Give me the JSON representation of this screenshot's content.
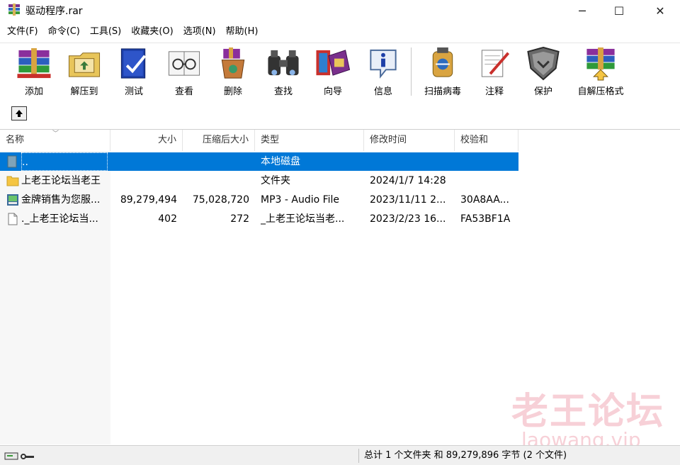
{
  "window": {
    "title": "驱动程序.rar",
    "minimize": "─",
    "maximize": "☐",
    "close": "✕"
  },
  "menu": [
    "文件(F)",
    "命令(C)",
    "工具(S)",
    "收藏夹(O)",
    "选项(N)",
    "帮助(H)"
  ],
  "toolbar": {
    "items": [
      {
        "label": "添加",
        "icon": "add-books-icon"
      },
      {
        "label": "解压到",
        "icon": "extract-folder-icon"
      },
      {
        "label": "测试",
        "icon": "test-book-icon"
      },
      {
        "label": "查看",
        "icon": "view-glasses-icon"
      },
      {
        "label": "删除",
        "icon": "delete-recycle-icon"
      },
      {
        "label": "查找",
        "icon": "find-binoculars-icon"
      },
      {
        "label": "向导",
        "icon": "wizard-icon"
      },
      {
        "label": "信息",
        "icon": "info-icon"
      },
      {
        "label": "扫描病毒",
        "icon": "scan-virus-icon"
      },
      {
        "label": "注释",
        "icon": "comment-icon"
      },
      {
        "label": "保护",
        "icon": "protect-shield-icon"
      },
      {
        "label": "自解压格式",
        "icon": "sfx-icon"
      }
    ]
  },
  "columns": {
    "name": "名称",
    "size": "大小",
    "packed": "压缩后大小",
    "type": "类型",
    "modified": "修改时间",
    "crc": "校验和"
  },
  "rows": [
    {
      "name": "..",
      "size": "",
      "packed": "",
      "type": "本地磁盘",
      "modified": "",
      "crc": "",
      "icon": "parent-folder-icon",
      "selected": true
    },
    {
      "name": "上老王论坛当老王",
      "size": "",
      "packed": "",
      "type": "文件夹",
      "modified": "2024/1/7 14:28",
      "crc": "",
      "icon": "folder-icon"
    },
    {
      "name": "金牌销售为您服...",
      "size": "89,279,494",
      "packed": "75,028,720",
      "type": "MP3 - Audio File",
      "modified": "2023/11/11 2...",
      "crc": "30A8AA...",
      "icon": "audio-file-icon"
    },
    {
      "name": "._上老王论坛当...",
      "size": "402",
      "packed": "272",
      "type": "_上老王论坛当老...",
      "modified": "2023/2/23 16...",
      "crc": "FA53BF1A",
      "icon": "file-icon"
    }
  ],
  "status": {
    "text": "总计 1 个文件夹 和 89,279,896 字节 (2 个文件)"
  },
  "watermark": {
    "line1": "老王论坛",
    "line2": "laowang.vip"
  },
  "colors": {
    "selection": "#0078d7",
    "folder": "#f5c542",
    "watermark": "#e8788c"
  }
}
